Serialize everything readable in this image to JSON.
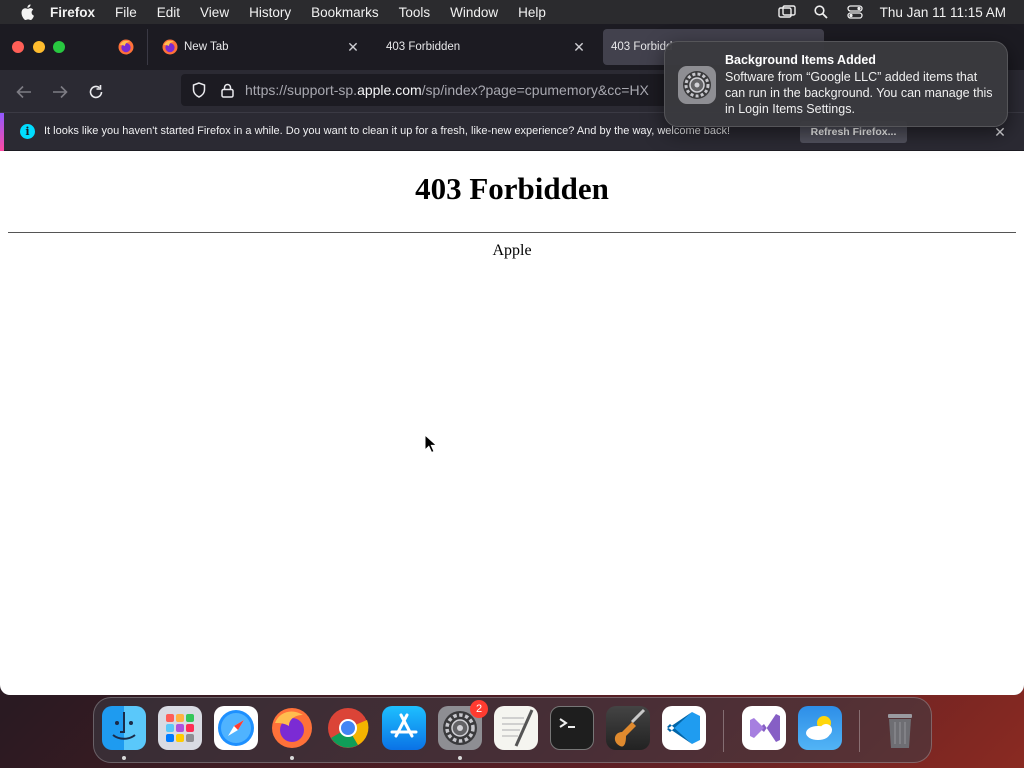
{
  "menubar": {
    "app_name": "Firefox",
    "items": [
      "File",
      "Edit",
      "View",
      "History",
      "Bookmarks",
      "Tools",
      "Window",
      "Help"
    ],
    "clock": "Thu Jan 11  11:15 AM"
  },
  "tabs": [
    {
      "label": "New Tab"
    },
    {
      "label": "403 Forbidden"
    },
    {
      "label": "403 Forbidd"
    }
  ],
  "urlbar": {
    "prefix": "https://support-sp.",
    "host": "apple.com",
    "path": "/sp/index?page=cpumemory&cc=HX"
  },
  "infobar": {
    "message": "It looks like you haven't started Firefox in a while. Do you want to clean it up for a fresh, like-new experience? And by the way, welcome back!",
    "button_label": "Refresh Firefox..."
  },
  "page": {
    "heading": "403 Forbidden",
    "server": "Apple"
  },
  "notification": {
    "title": "Background Items Added",
    "body": "Software from “Google LLC” added items that can run in the background. You can manage this in Login Items Settings."
  },
  "dock": {
    "items": [
      "Finder",
      "Launchpad",
      "Safari",
      "Firefox",
      "Google Chrome",
      "App Store",
      "System Settings",
      "TextEdit",
      "Terminal",
      "GarageBand",
      "Visual Studio Code",
      "Visual Studio",
      "Weather",
      "Trash"
    ],
    "settings_badge": "2"
  },
  "colors": {
    "accent": "#00ddff",
    "close": "#ff5f57",
    "minimize": "#febc2e",
    "maximize": "#28c840",
    "badge": "#ff3b30"
  }
}
